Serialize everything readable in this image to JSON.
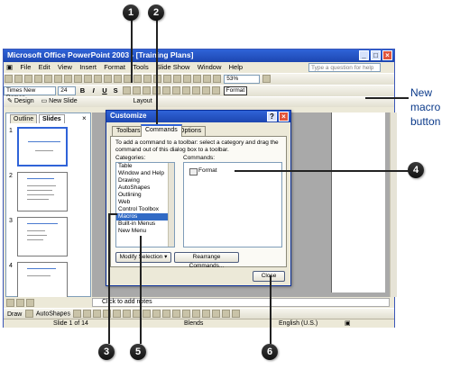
{
  "window": {
    "title": "Microsoft Office PowerPoint 2003 - [Training Plans]",
    "menus": [
      "File",
      "Edit",
      "View",
      "Insert",
      "Format",
      "Tools",
      "Slide Show",
      "Window",
      "Help"
    ],
    "help_placeholder": "Type a question for help",
    "zoom": "53%",
    "font_name": "Times New Roman",
    "font_size": "24",
    "format_button": "Format",
    "design_button": "Design",
    "new_slide_button": "New Slide",
    "layout_label": "Layout"
  },
  "left_panel": {
    "tabs": [
      "Outline",
      "Slides"
    ],
    "slide_numbers": [
      "1",
      "2",
      "3",
      "4"
    ]
  },
  "notes_placeholder": "Click to add notes",
  "draw_toolbar": {
    "draw_label": "Draw",
    "autoshapes_label": "AutoShapes"
  },
  "status_bar": {
    "slide_info": "Slide 1 of 14",
    "design": "Blends",
    "language": "English (U.S.)"
  },
  "dialog": {
    "title": "Customize",
    "tabs": [
      "Toolbars",
      "Commands",
      "Options"
    ],
    "instructions": "To add a command to a toolbar: select a category and drag the command out of this dialog box to a toolbar.",
    "categories_label": "Categories:",
    "commands_label": "Commands:",
    "categories": [
      "Table",
      "Window and Help",
      "Drawing",
      "AutoShapes",
      "Outlining",
      "Web",
      "Control Toolbox",
      "Macros",
      "Built-in Menus",
      "New Menu"
    ],
    "selected_category": "Macros",
    "command_item": "Format",
    "modify_selection": "Modify Selection",
    "rearrange_commands": "Rearrange Commands...",
    "close_button": "Close"
  },
  "callouts": {
    "c1": "1",
    "c2": "2",
    "c3": "3",
    "c4": "4",
    "c5": "5",
    "c6": "6",
    "new_macro_label": "New macro button"
  }
}
